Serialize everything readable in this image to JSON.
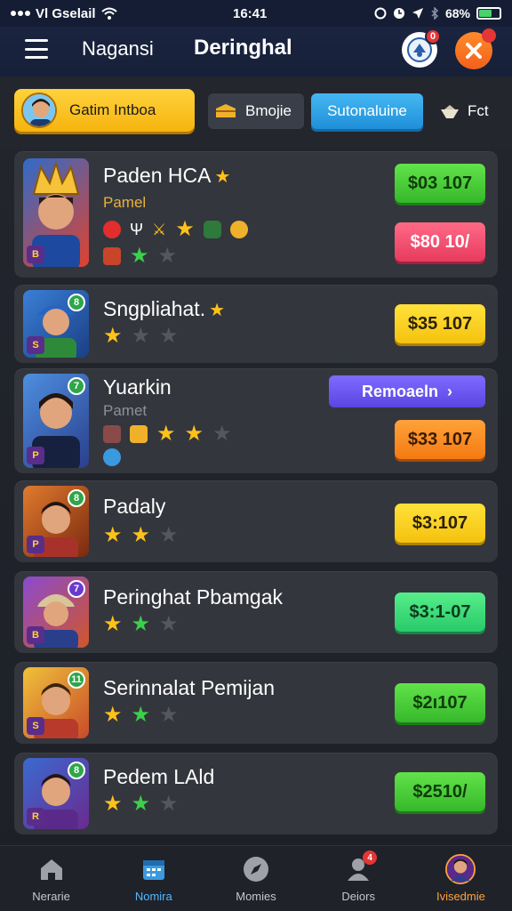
{
  "status_bar": {
    "carrier": "Vl Gselail",
    "time": "16:41",
    "battery": "68%",
    "battery_level": 0.68
  },
  "topnav": {
    "title": "Nagansi",
    "brand": "Deringhal",
    "avatar_badge": "0"
  },
  "tabs": [
    {
      "label": "Gatim Intboa",
      "icon": "avatar-icon"
    },
    {
      "label": "Bmojie",
      "icon": "chest-icon"
    },
    {
      "label": "Sutonaluine",
      "icon": ""
    },
    {
      "label": "Fct",
      "icon": "hat-icon"
    }
  ],
  "players": [
    {
      "name": "Paden HCA",
      "subtitle": "Pamel",
      "price_primary": "$03 107",
      "price_secondary": "$80 10/",
      "stars": [
        "green",
        "gray"
      ],
      "level": ""
    },
    {
      "name": "Sngpliahat.",
      "subtitle": "",
      "price_primary": "$35 107",
      "stars": [
        "gold",
        "gray",
        "gray"
      ],
      "level": "8"
    },
    {
      "name": "Yuarkin",
      "subtitle": "Pamet",
      "remove_label": "Remoaeln",
      "price_primary": "$33 107",
      "stars": [
        "gold",
        "gold",
        "gray"
      ],
      "level": "7"
    },
    {
      "name": "Padaly",
      "subtitle": "",
      "price_primary": "$3:107",
      "stars": [
        "gold",
        "gold",
        "gray"
      ],
      "level": "8"
    },
    {
      "name": "Peringhat Pbamgak",
      "subtitle": "",
      "price_primary": "$3:1-07",
      "stars": [
        "gold",
        "green",
        "gray"
      ],
      "level": "7"
    },
    {
      "name": "Serinnalat Pemijan",
      "subtitle": "",
      "price_primary": "$2ı107",
      "stars": [
        "gold",
        "green",
        "gray"
      ],
      "level": "11"
    },
    {
      "name": "Pedem LAld",
      "subtitle": "",
      "price_primary": "$2510/",
      "stars": [
        "gold",
        "green",
        "gray"
      ],
      "level": "8"
    }
  ],
  "bottom_nav": [
    {
      "label": "Nerarie",
      "icon": "home-icon"
    },
    {
      "label": "Nomira",
      "icon": "calendar-icon"
    },
    {
      "label": "Momies",
      "icon": "compass-icon"
    },
    {
      "label": "Deiors",
      "icon": "user-icon",
      "badge": "4"
    },
    {
      "label": "Ivisedmie",
      "icon": "profile-icon"
    }
  ]
}
